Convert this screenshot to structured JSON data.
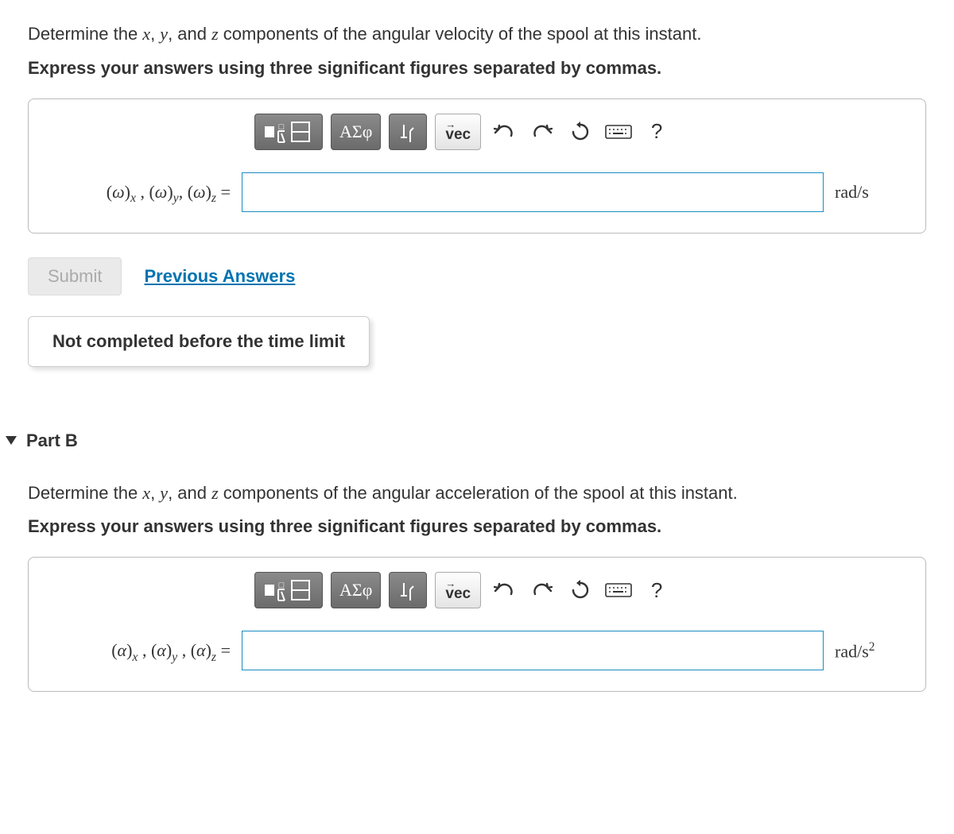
{
  "partA": {
    "prompt_pre": "Determine the ",
    "var_x": "x",
    "sep1": ", ",
    "var_y": "y",
    "sep2": ", and ",
    "var_z": "z",
    "prompt_post": " components of the angular velocity of the spool at this instant.",
    "instruct": "Express your answers using three significant figures separated by commas.",
    "labelSym": "ω",
    "unit": "rad/s",
    "submit": "Submit",
    "prev": "Previous Answers",
    "status": "Not completed before the time limit"
  },
  "partB": {
    "title": "Part B",
    "prompt_pre": "Determine the ",
    "var_x": "x",
    "sep1": ", ",
    "var_y": "y",
    "sep2": ", and ",
    "var_z": "z",
    "prompt_post": " components of the angular acceleration of the spool at this instant.",
    "instruct": "Express your answers using three significant figures separated by commas.",
    "labelSym": "α",
    "unit_pre": "rad/s",
    "unit_sup": "2"
  },
  "toolbar": {
    "greek": "ΑΣφ",
    "vec": "vec",
    "help": "?"
  }
}
